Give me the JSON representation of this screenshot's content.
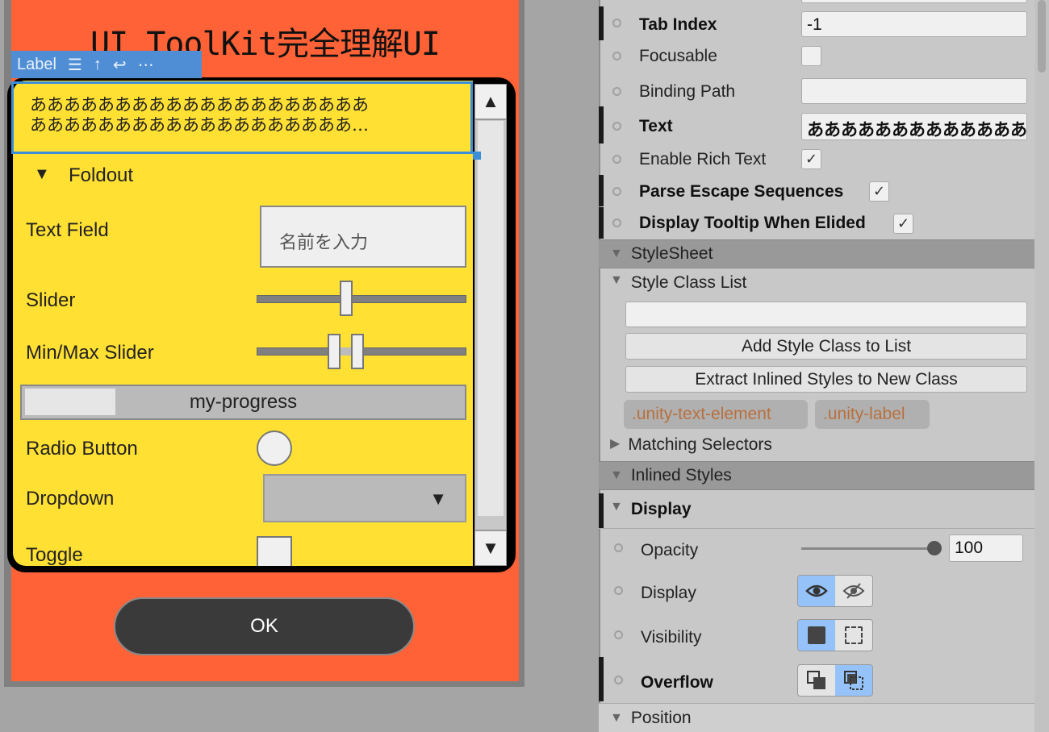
{
  "canvas": {
    "title": "UI ToolKit完全理解UI",
    "label_tag": {
      "name": "Label",
      "icons": [
        "align-icon",
        "align-top-icon",
        "wrap-icon",
        "more-icon"
      ]
    },
    "label_text_line1": "ああああああああああああああああああああ",
    "label_text_line2": "あああああああああああああああああああ…",
    "foldout": "Foldout",
    "text_field": {
      "label": "Text Field",
      "placeholder": "名前を入力"
    },
    "slider": {
      "label": "Slider",
      "value_percent": 42
    },
    "minmax_slider": {
      "label": "Min/Max Slider",
      "min_percent": 37,
      "max_percent": 49
    },
    "progress": {
      "label": "my-progress",
      "value_percent": 21
    },
    "radio": {
      "label": "Radio Button",
      "checked": false
    },
    "dropdown": {
      "label": "Dropdown",
      "value": ""
    },
    "toggle": {
      "label": "Toggle",
      "checked": false
    },
    "ok_button": "OK",
    "colors": {
      "background": "#ff6236",
      "panel": "#ffe033",
      "button": "#3a3a3a",
      "selection": "#3b8fd9"
    }
  },
  "inspector": {
    "tab_index": {
      "label": "Tab Index",
      "value": "-1"
    },
    "focusable": {
      "label": "Focusable",
      "checked": false
    },
    "binding_path": {
      "label": "Binding Path",
      "value": ""
    },
    "text": {
      "label": "Text",
      "value": "ああああああああああああああ"
    },
    "enable_rich_text": {
      "label": "Enable Rich Text",
      "checked": true
    },
    "parse_escape": {
      "label": "Parse Escape Sequences",
      "checked": true
    },
    "tooltip_elided": {
      "label": "Display Tooltip When Elided",
      "checked": true
    },
    "stylesheet_header": "StyleSheet",
    "style_class_list": "Style Class List",
    "style_class_input": "",
    "add_style_class": "Add Style Class to List",
    "extract_styles": "Extract Inlined Styles to New Class",
    "classes": [
      ".unity-text-element",
      ".unity-label"
    ],
    "matching_selectors": "Matching Selectors",
    "inlined_styles": "Inlined Styles",
    "display_section": "Display",
    "opacity": {
      "label": "Opacity",
      "value": "100"
    },
    "display": {
      "label": "Display",
      "selected": "visible"
    },
    "visibility": {
      "label": "Visibility",
      "selected": "visible"
    },
    "overflow": {
      "label": "Overflow",
      "selected": "hidden"
    },
    "position_section": "Position",
    "check_mark": "✓"
  }
}
